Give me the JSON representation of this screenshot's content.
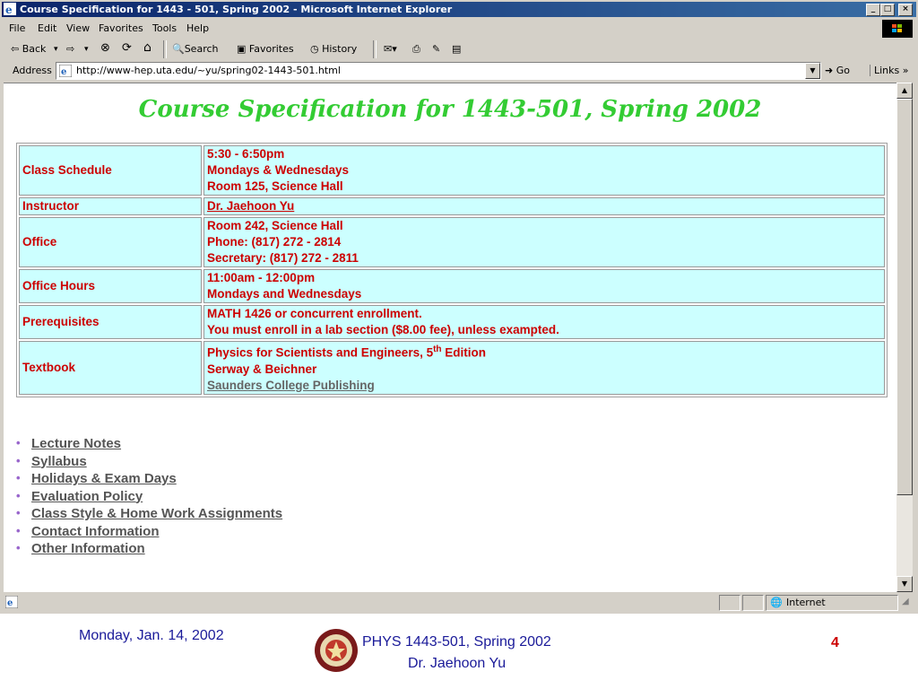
{
  "window": {
    "title": "Course Specification for 1443 - 501, Spring 2002 - Microsoft Internet Explorer",
    "min": "_",
    "max": "□",
    "close": "×"
  },
  "menu": [
    "File",
    "Edit",
    "View",
    "Favorites",
    "Tools",
    "Help"
  ],
  "toolbar": {
    "back": "⇦ Back",
    "forward": "⇨",
    "stop": "⊗",
    "refresh": "⟳",
    "home": "⌂",
    "search": "Search",
    "favorites": "Favorites",
    "history": "History"
  },
  "address": {
    "label": "Address",
    "url": "http://www-hep.uta.edu/~yu/spring02-1443-501.html",
    "go": "Go",
    "links": "Links »"
  },
  "page": {
    "title": "Course Specification for 1443-501, Spring 2002",
    "rows": [
      {
        "label": "Class Schedule",
        "lines": [
          "5:30 - 6:50pm",
          "Mondays & Wednesdays",
          "Room 125, Science Hall"
        ]
      },
      {
        "label": "Instructor",
        "lines": [
          "Dr. Jaehoon Yu"
        ]
      },
      {
        "label": "Office",
        "lines": [
          "Room 242, Science Hall",
          "Phone: (817) 272 - 2814",
          "Secretary: (817) 272 - 2811"
        ]
      },
      {
        "label": "Office Hours",
        "lines": [
          "11:00am - 12:00pm",
          "Mondays and Wednesdays"
        ]
      },
      {
        "label": "Prerequisites",
        "lines": [
          "MATH 1426 or concurrent enrollment.",
          "You must enroll in a lab section ($8.00 fee), unless exampted."
        ]
      },
      {
        "label": "Textbook",
        "line1_pre": "Physics for Scientists and Engineers, 5",
        "line1_sup": "th",
        "line1_post": " Edition",
        "lines": [
          "Serway & Beichner",
          "Saunders College Publishing"
        ]
      }
    ],
    "links": [
      "Lecture Notes",
      "Syllabus",
      "Holidays & Exam Days",
      "Evaluation Policy",
      "Class Style & Home Work Assignments",
      "Contact Information",
      "Other Information"
    ]
  },
  "status": {
    "zone": "Internet"
  },
  "footer": {
    "date": "Monday, Jan. 14, 2002",
    "course": "PHYS 1443-501, Spring 2002",
    "instructor": "Dr. Jaehoon Yu",
    "page": "4"
  },
  "colors": {
    "title_green": "#33cc33",
    "text_red": "#cc0000",
    "cell_bg": "#ccffff",
    "footer_blue": "#1a1a99"
  }
}
